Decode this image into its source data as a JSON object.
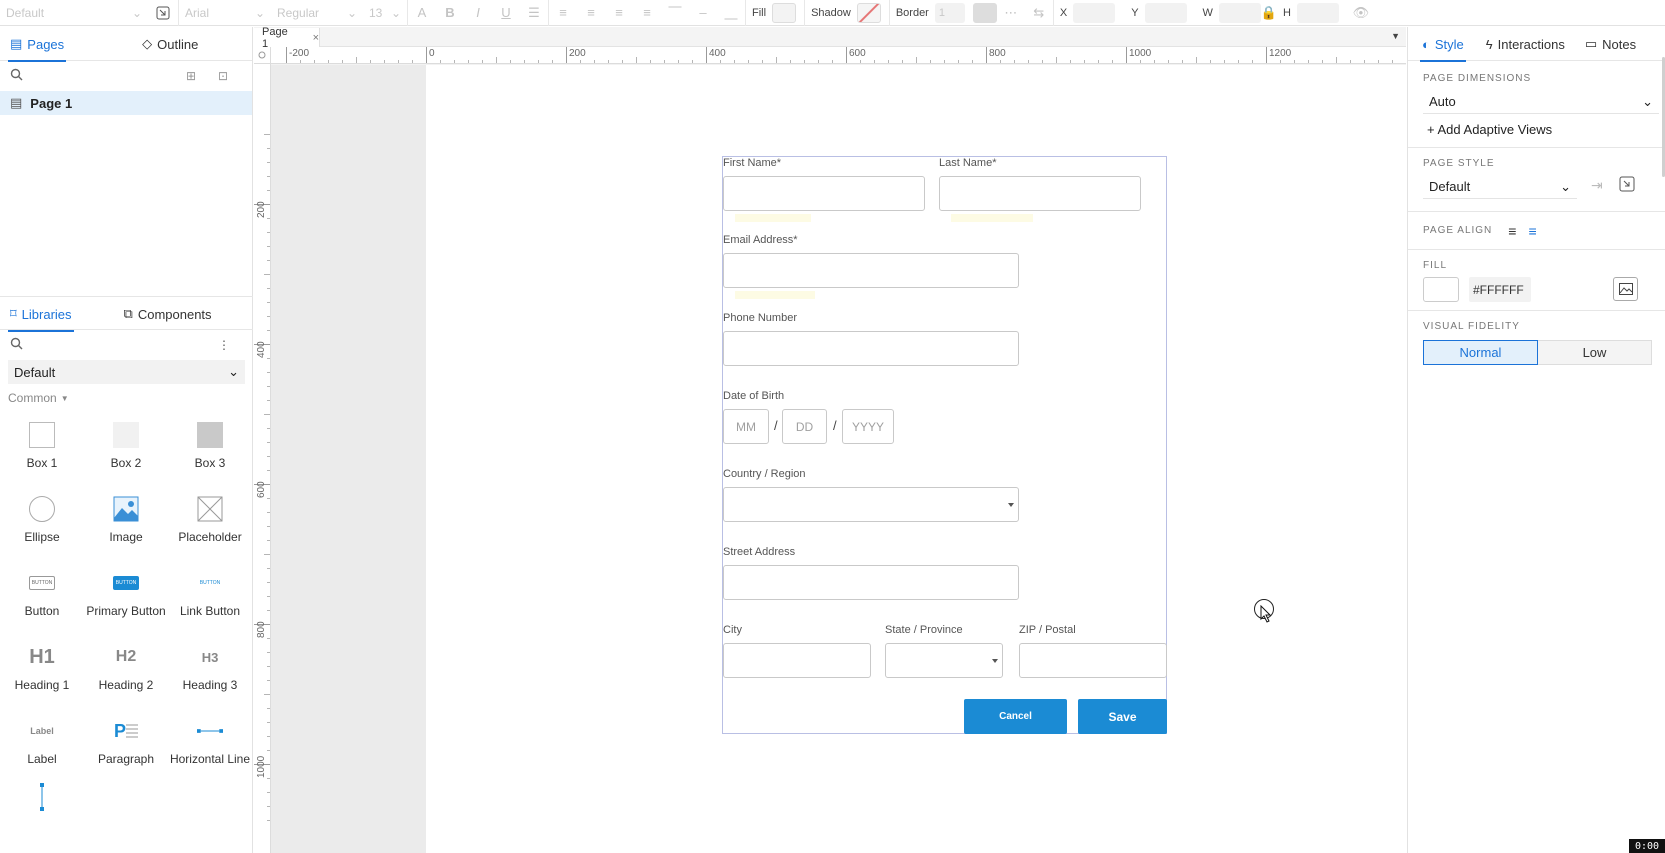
{
  "toolbar": {
    "style_select": "Default",
    "font_select": "Arial",
    "weight_select": "Regular",
    "size_select": "13",
    "fill_label": "Fill",
    "shadow_label": "Shadow",
    "border_label": "Border",
    "border_value": "1",
    "x_label": "X",
    "y_label": "Y",
    "w_label": "W",
    "h_label": "H"
  },
  "left": {
    "tabs": {
      "pages": "Pages",
      "outline": "Outline"
    },
    "pages": [
      {
        "label": "Page 1"
      }
    ],
    "lib_tabs": {
      "libraries": "Libraries",
      "components": "Components"
    },
    "library_select": "Default",
    "category": "Common",
    "widgets": [
      {
        "label": "Box 1",
        "icon": "box1-icon"
      },
      {
        "label": "Box 2",
        "icon": "box2-icon"
      },
      {
        "label": "Box 3",
        "icon": "box3-icon"
      },
      {
        "label": "Ellipse",
        "icon": "ellipse-icon"
      },
      {
        "label": "Image",
        "icon": "image-icon"
      },
      {
        "label": "Placeholder",
        "icon": "placeholder-icon"
      },
      {
        "label": "Button",
        "icon": "button-icon",
        "thumb": "BUTTON"
      },
      {
        "label": "Primary Button",
        "icon": "primary-button-icon",
        "thumb": "BUTTON"
      },
      {
        "label": "Link Button",
        "icon": "link-button-icon",
        "thumb": "BUTTON"
      },
      {
        "label": "Heading 1",
        "icon": "heading1-icon",
        "thumb": "H1"
      },
      {
        "label": "Heading 2",
        "icon": "heading2-icon",
        "thumb": "H2"
      },
      {
        "label": "Heading 3",
        "icon": "heading3-icon",
        "thumb": "H3"
      },
      {
        "label": "Label",
        "icon": "label-icon",
        "thumb": "Label"
      },
      {
        "label": "Paragraph",
        "icon": "paragraph-icon",
        "thumb": "P"
      },
      {
        "label": "Horizontal Line",
        "icon": "hline-icon"
      }
    ]
  },
  "canvas": {
    "page_tab": "Page 1",
    "ruler_top": [
      "-200",
      "0",
      "200",
      "400",
      "600",
      "800",
      "1000",
      "1200"
    ],
    "ruler_left": [
      "200",
      "400",
      "600",
      "800",
      "1000"
    ]
  },
  "form": {
    "first_name": "First Name*",
    "last_name": "Last Name*",
    "email": "Email Address*",
    "phone": "Phone Number",
    "dob": "Date of Birth",
    "mm": "MM",
    "dd": "DD",
    "yyyy": "YYYY",
    "slash": "/",
    "country": "Country / Region",
    "street": "Street Address",
    "city": "City",
    "state": "State / Province",
    "zip": "ZIP / Postal",
    "cancel": "Cancel",
    "save": "Save"
  },
  "right": {
    "tabs": {
      "style": "Style",
      "interactions": "Interactions",
      "notes": "Notes"
    },
    "page_dimensions_title": "PAGE DIMENSIONS",
    "page_dimensions_value": "Auto",
    "add_adaptive": "Add Adaptive Views",
    "page_style_title": "PAGE STYLE",
    "page_style_value": "Default",
    "page_align_title": "PAGE ALIGN",
    "fill_title": "FILL",
    "fill_hex": "#FFFFFF",
    "visual_fidelity_title": "VISUAL FIDELITY",
    "fidelity_normal": "Normal",
    "fidelity_low": "Low"
  },
  "timecode": "0:00",
  "colors": {
    "accent": "#1b73d8",
    "button": "#1b8bd4",
    "selection": "#e3f0fb"
  }
}
